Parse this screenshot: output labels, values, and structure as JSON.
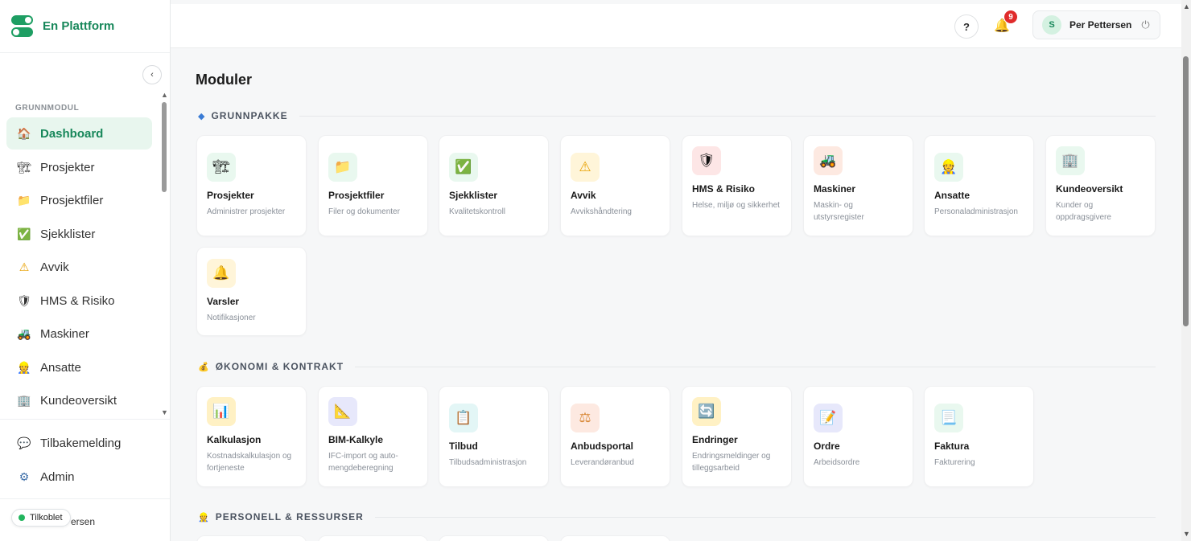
{
  "brand": {
    "name": "En Plattform"
  },
  "sidebar": {
    "collapse_icon": "‹",
    "section_label": "GRUNNMODUL",
    "items": [
      {
        "label": "Dashboard",
        "icon": "🏠"
      },
      {
        "label": "Prosjekter",
        "icon": "🏗"
      },
      {
        "label": "Prosjektfiler",
        "icon": "📁"
      },
      {
        "label": "Sjekklister",
        "icon": "✅"
      },
      {
        "label": "Avvik",
        "icon": "⚠"
      },
      {
        "label": "HMS & Risiko",
        "icon": "🛡"
      },
      {
        "label": "Maskiner",
        "icon": "🚜"
      },
      {
        "label": "Ansatte",
        "icon": "👷"
      },
      {
        "label": "Kundeoversikt",
        "icon": "🏢"
      }
    ],
    "bottom_items": [
      {
        "label": "Tilbakemelding",
        "icon": "💬"
      },
      {
        "label": "Admin",
        "icon": "⚙"
      }
    ],
    "user_fragment": "ersen",
    "status": "Tilkoblet"
  },
  "header": {
    "help_label": "?",
    "notification_count": "9",
    "user_initial": "S",
    "user_name": "Per Pettersen",
    "power_icon": "⏻"
  },
  "main": {
    "title": "Moduler",
    "groups": [
      {
        "icon": "◆",
        "label": "GRUNNPAKKE"
      },
      {
        "icon": "💰",
        "label": "ØKONOMI & KONTRAKT"
      },
      {
        "icon": "👷",
        "label": "PERSONELL & RESSURSER"
      }
    ],
    "grunnpakke": [
      {
        "title": "Prosjekter",
        "sub": "Administrer prosjekter",
        "icon": "🏗"
      },
      {
        "title": "Prosjektfiler",
        "sub": "Filer og dokumenter",
        "icon": "📁"
      },
      {
        "title": "Sjekklister",
        "sub": "Kvalitetskontroll",
        "icon": "✅"
      },
      {
        "title": "Avvik",
        "sub": "Avvikshåndtering",
        "icon": "⚠"
      },
      {
        "title": "HMS & Risiko",
        "sub": "Helse, miljø og sikkerhet",
        "icon": "🛡"
      },
      {
        "title": "Maskiner",
        "sub": "Maskin- og utstyrsregister",
        "icon": "🚜"
      },
      {
        "title": "Ansatte",
        "sub": "Personaladministrasjon",
        "icon": "👷"
      },
      {
        "title": "Kundeoversikt",
        "sub": "Kunder og oppdragsgivere",
        "icon": "🏢"
      },
      {
        "title": "Varsler",
        "sub": "Notifikasjoner",
        "icon": "🔔"
      }
    ],
    "okonomi": [
      {
        "title": "Kalkulasjon",
        "sub": "Kostnadskalkulasjon og fortjeneste",
        "icon": "📊"
      },
      {
        "title": "BIM-Kalkyle",
        "sub": "IFC-import og auto-mengdeberegning",
        "icon": "📐"
      },
      {
        "title": "Tilbud",
        "sub": "Tilbudsadministrasjon",
        "icon": "📋"
      },
      {
        "title": "Anbudsportal",
        "sub": "Leverandøranbud",
        "icon": "⚖"
      },
      {
        "title": "Endringer",
        "sub": "Endringsmeldinger og tilleggsarbeid",
        "icon": "🔄"
      },
      {
        "title": "Ordre",
        "sub": "Arbeidsordre",
        "icon": "📝"
      },
      {
        "title": "Faktura",
        "sub": "Fakturering",
        "icon": "📃"
      }
    ]
  }
}
